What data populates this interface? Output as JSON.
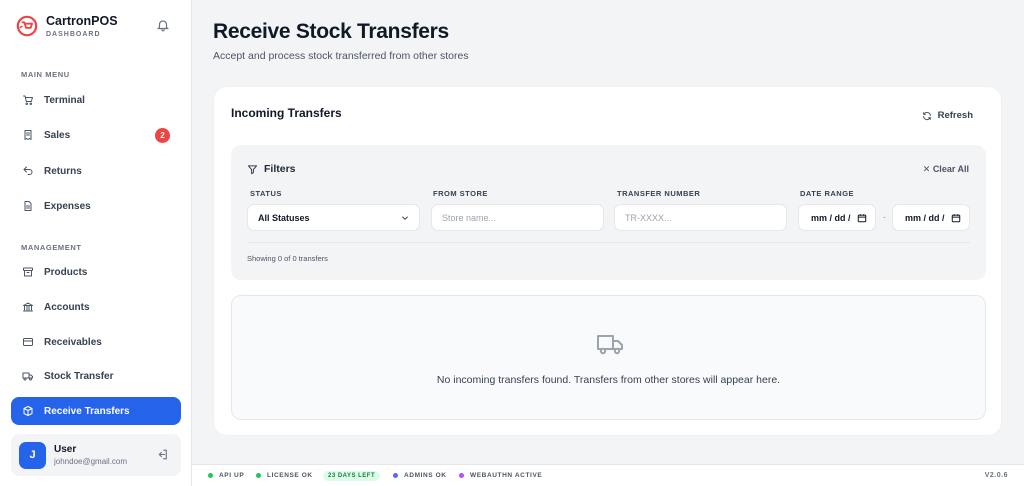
{
  "app": {
    "name": "CartronPOS",
    "subtitle": "DASHBOARD",
    "accent_color": "#2563eb",
    "logo_color": "#ef4444"
  },
  "sidebar": {
    "main_menu_label": "MAIN MENU",
    "management_label": "MANAGEMENT",
    "main_items": [
      {
        "label": "Terminal",
        "icon": "cart-icon"
      },
      {
        "label": "Sales",
        "icon": "receipt-icon",
        "badge": "2"
      },
      {
        "label": "Returns",
        "icon": "return-arrow-icon"
      },
      {
        "label": "Expenses",
        "icon": "document-icon"
      }
    ],
    "management_items": [
      {
        "label": "Products",
        "icon": "archive-box-icon"
      },
      {
        "label": "Accounts",
        "icon": "bank-icon"
      },
      {
        "label": "Receivables",
        "icon": "credit-card-icon"
      },
      {
        "label": "Stock Transfer",
        "icon": "truck-icon"
      },
      {
        "label": "Receive Transfers",
        "icon": "package-icon",
        "active": true
      }
    ],
    "user": {
      "initial": "J",
      "name": "User",
      "email": "johndoe@gmail.com"
    }
  },
  "page": {
    "title": "Receive Stock Transfers",
    "subtitle": "Accept and process stock transferred from other stores"
  },
  "card": {
    "title": "Incoming Transfers",
    "refresh_label": "Refresh",
    "filters": {
      "heading": "Filters",
      "clear_label": "Clear All",
      "status_label": "STATUS",
      "status_value": "All Statuses",
      "from_store_label": "FROM STORE",
      "from_store_placeholder": "Store name...",
      "transfer_number_label": "TRANSFER NUMBER",
      "transfer_number_placeholder": "TR-XXXX...",
      "date_range_label": "DATE RANGE",
      "date_from": "mm / dd /",
      "date_separator": "-",
      "date_to": "mm / dd /",
      "showing_text": "Showing 0 of 0 transfers"
    },
    "empty_message": "No incoming transfers found. Transfers from other stores will appear here."
  },
  "statusbar": {
    "api": {
      "label": "API UP",
      "color": "#22c55e"
    },
    "license": {
      "label": "LICENSE OK",
      "color": "#22c55e"
    },
    "days_left": "23 DAYS LEFT",
    "admins": {
      "label": "ADMINS OK",
      "color": "#6366f1"
    },
    "webauthn": {
      "label": "WEBAUTHN ACTIVE",
      "color": "#a855f7"
    },
    "version": "V2.0.6"
  }
}
